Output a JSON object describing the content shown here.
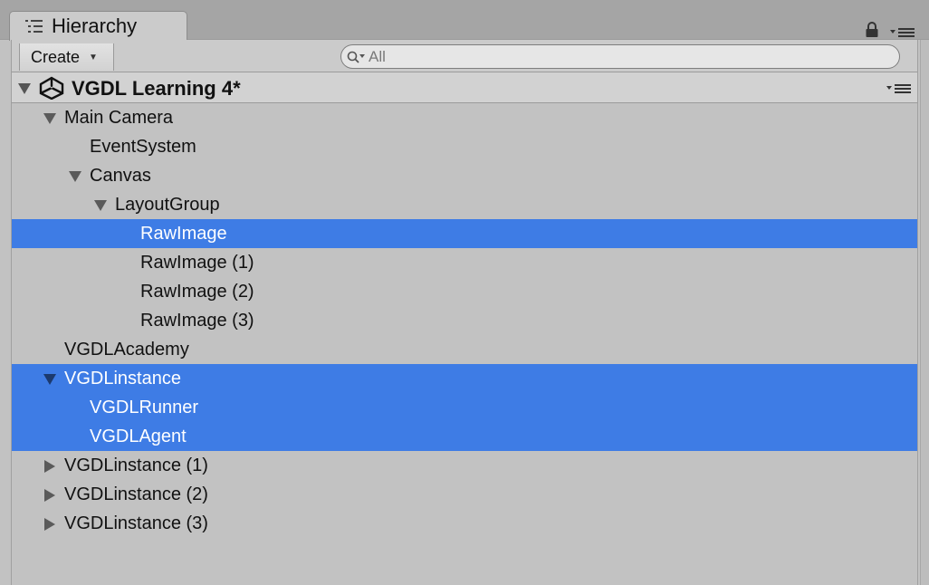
{
  "tab": {
    "title": "Hierarchy",
    "icon": "hierarchy-list-icon",
    "lock_icon": "lock-icon",
    "menu_icon": "panel-menu-icon"
  },
  "toolbar": {
    "create_label": "Create",
    "create_caret": "▼",
    "search_placeholder": "All",
    "search_value": ""
  },
  "scene": {
    "title": "VGDL Learning 4*",
    "icon": "unity-logo-icon",
    "menu_icon": "scene-menu-icon"
  },
  "colors": {
    "selection": "#3e7ce5",
    "background": "#c2c2c2",
    "text": "#111111",
    "selected_text": "#ffffff"
  },
  "tree": [
    {
      "label": "Main Camera",
      "depth": 0,
      "expander": "expanded",
      "selected": false
    },
    {
      "label": "EventSystem",
      "depth": 1,
      "expander": "none",
      "selected": false
    },
    {
      "label": "Canvas",
      "depth": 1,
      "expander": "expanded",
      "selected": false
    },
    {
      "label": "LayoutGroup",
      "depth": 2,
      "expander": "expanded",
      "selected": false
    },
    {
      "label": "RawImage",
      "depth": 3,
      "expander": "none",
      "selected": true
    },
    {
      "label": "RawImage (1)",
      "depth": 3,
      "expander": "none",
      "selected": false
    },
    {
      "label": "RawImage (2)",
      "depth": 3,
      "expander": "none",
      "selected": false
    },
    {
      "label": "RawImage (3)",
      "depth": 3,
      "expander": "none",
      "selected": false
    },
    {
      "label": "VGDLAcademy",
      "depth": 0,
      "expander": "none",
      "selected": false
    },
    {
      "label": "VGDLinstance",
      "depth": 0,
      "expander": "expanded",
      "selected": true
    },
    {
      "label": "VGDLRunner",
      "depth": 1,
      "expander": "none",
      "selected": true
    },
    {
      "label": "VGDLAgent",
      "depth": 1,
      "expander": "none",
      "selected": true
    },
    {
      "label": "VGDLinstance (1)",
      "depth": 0,
      "expander": "collapsed",
      "selected": false
    },
    {
      "label": "VGDLinstance (2)",
      "depth": 0,
      "expander": "collapsed",
      "selected": false
    },
    {
      "label": "VGDLinstance (3)",
      "depth": 0,
      "expander": "collapsed",
      "selected": false
    }
  ]
}
